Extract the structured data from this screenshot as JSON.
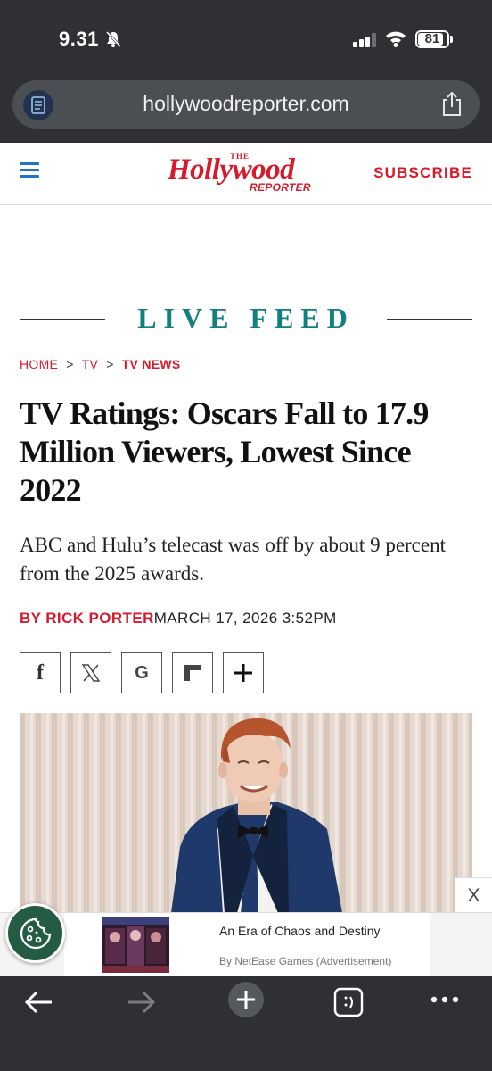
{
  "status_bar": {
    "time": "9.31",
    "battery": "81",
    "battery_fraction": 0.81
  },
  "browser": {
    "url": "hollywoodreporter.com"
  },
  "header": {
    "logo": {
      "the": "THE",
      "main": "Hollywood",
      "sub": "REPORTER"
    },
    "subscribe_label": "SUBSCRIBE"
  },
  "section": {
    "label": "LIVE FEED"
  },
  "breadcrumb": {
    "items": [
      "HOME",
      "TV",
      "TV NEWS"
    ],
    "separator": ">"
  },
  "article": {
    "headline": "TV Ratings: Oscars Fall to 17.9 Million Viewers, Lowest Since 2022",
    "dek": "ABC and Hulu’s telecast was off by about 9 percent from the 2025 awards.",
    "author": "BY RICK PORTER",
    "date": "MARCH 17, 2026 3:52PM"
  },
  "share": {
    "icons": [
      "facebook-icon",
      "x-icon",
      "google-icon",
      "flipboard-icon",
      "plus-icon"
    ],
    "facebook_glyph": "f",
    "google_glyph": "G"
  },
  "ad": {
    "close": "X",
    "title": "An Era of Chaos and Destiny",
    "subtitle": "By NetEase Games (Advertisement)"
  },
  "colors": {
    "brand_red": "#d61a2b",
    "section_teal": "#138080",
    "link_blue": "#1d74c9",
    "chrome": "#2e3033"
  }
}
